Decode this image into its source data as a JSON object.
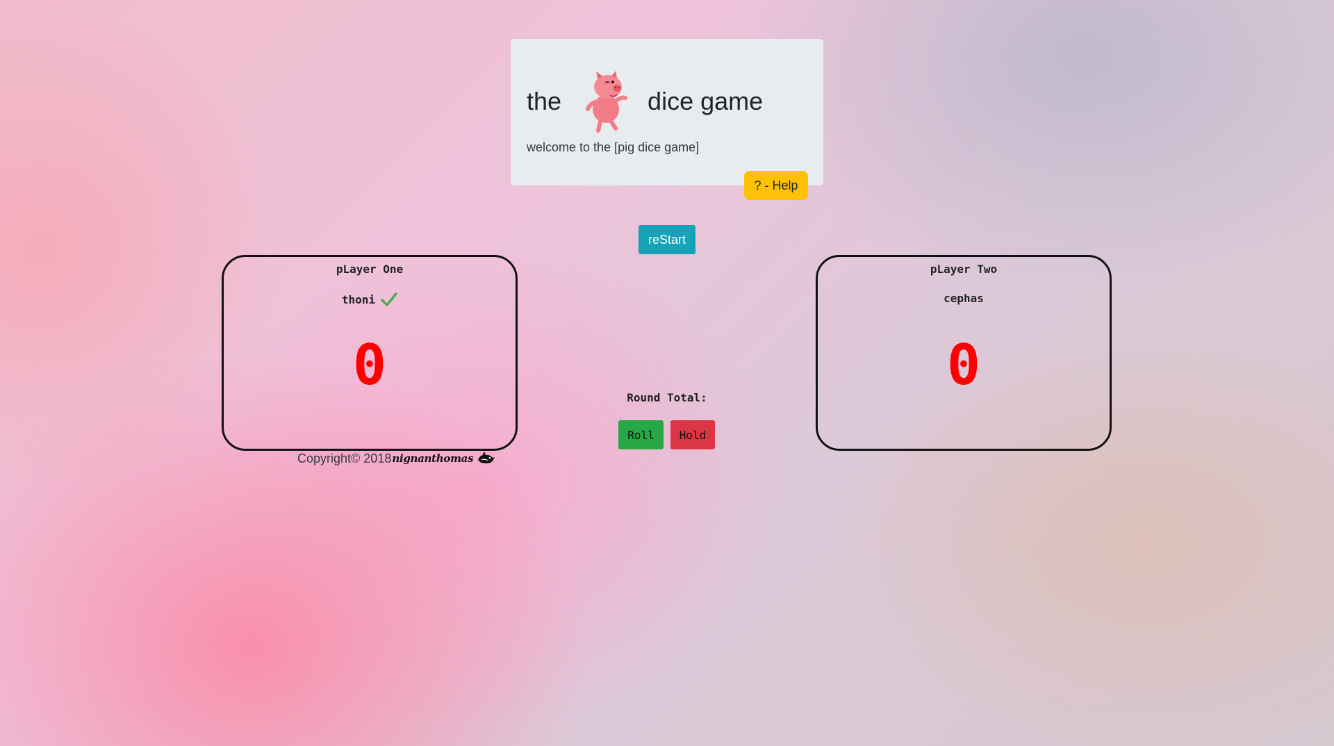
{
  "header": {
    "title_left": "the",
    "title_right": "dice game",
    "logo_icon": "pig-icon",
    "welcome": "welcome to the [pig dice game]",
    "help_label": "? - Help"
  },
  "controls": {
    "restart_label": "reStart",
    "round_total_label": "Round Total:",
    "roll_label": "Roll",
    "hold_label": "Hold"
  },
  "players": [
    {
      "label": "pLayer One",
      "name": "thoni",
      "score": "0",
      "active": true
    },
    {
      "label": "pLayer Two",
      "name": "cephas",
      "score": "0",
      "active": false
    }
  ],
  "footer": {
    "copyright": "Copyright© 2018",
    "author": "nignanthomas"
  },
  "colors": {
    "score": "#ff0000",
    "help": "#ffc107",
    "restart": "#17a2b8",
    "roll": "#28a745",
    "hold": "#dc3545",
    "active_check": "#4caf50"
  }
}
